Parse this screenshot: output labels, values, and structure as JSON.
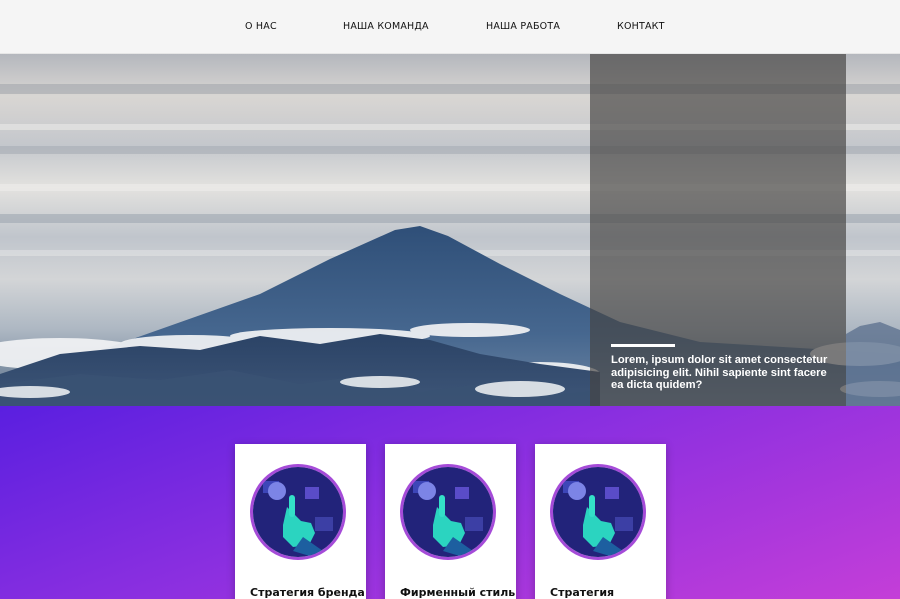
{
  "nav": {
    "items": [
      {
        "label": "О НАС"
      },
      {
        "label": "НАША КОМАНДА"
      },
      {
        "label": "НАША РАБОТА"
      },
      {
        "label": "КОНТАКТ"
      }
    ]
  },
  "hero": {
    "overlay_text": "Lorem, ipsum dolor sit amet consectetur adipisicing elit. Nihil sapiente sint facere ea dicta quidem?"
  },
  "services": {
    "cards": [
      {
        "title": "Стратегия бренда"
      },
      {
        "title": "Фирменный стиль"
      },
      {
        "title": "Стратегия"
      }
    ]
  },
  "colors": {
    "nav_bg": "#f5f5f5",
    "overlay": "rgba(70,68,66,0.68)",
    "gradient_start": "#5a1fe0",
    "gradient_end": "#c43ed8",
    "card_ring": "#a54bd8"
  }
}
